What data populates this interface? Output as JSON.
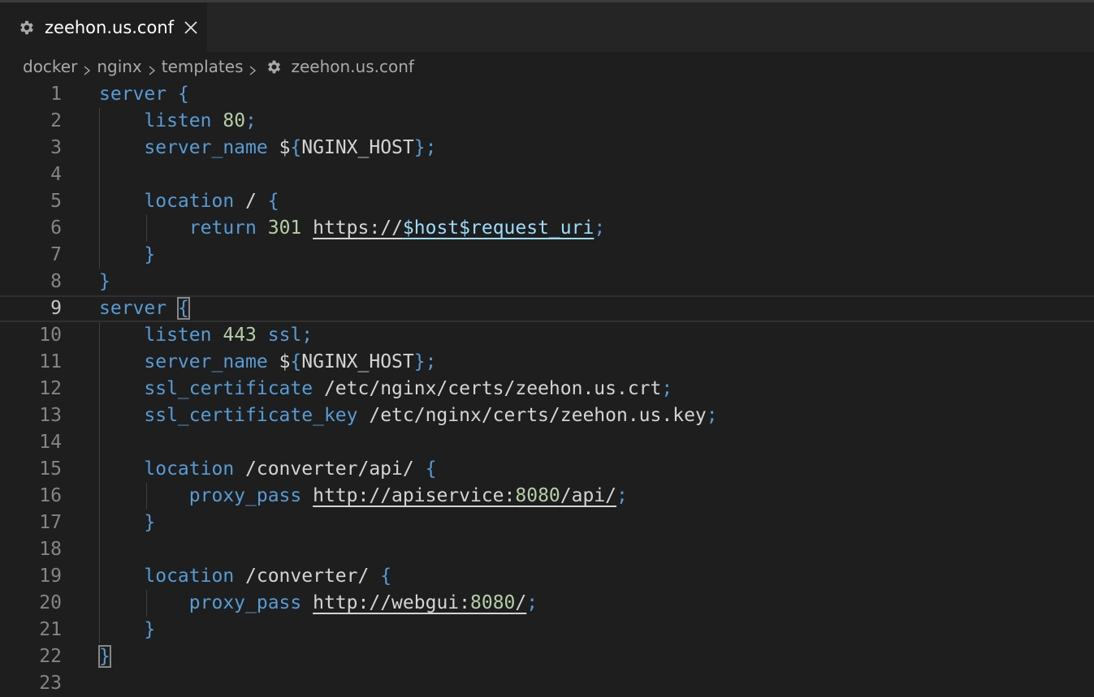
{
  "tab": {
    "icon": "gear-icon",
    "label": "zeehon.us.conf",
    "close_icon": "close-icon"
  },
  "breadcrumb": {
    "items": [
      "docker",
      "nginx",
      "templates"
    ],
    "file_icon": "gear-icon",
    "file": "zeehon.us.conf"
  },
  "editor": {
    "current_line": 9,
    "lines": [
      {
        "n": "1",
        "tokens": [
          [
            "kw",
            "server"
          ],
          [
            "txt",
            " "
          ],
          [
            "brace",
            "{"
          ]
        ]
      },
      {
        "n": "2",
        "tokens": [
          [
            "txt",
            "    "
          ],
          [
            "kw",
            "listen"
          ],
          [
            "txt",
            " "
          ],
          [
            "num",
            "80"
          ],
          [
            "kw",
            ";"
          ]
        ]
      },
      {
        "n": "3",
        "tokens": [
          [
            "txt",
            "    "
          ],
          [
            "kw",
            "server_name"
          ],
          [
            "txt",
            " $"
          ],
          [
            "brace",
            "{"
          ],
          [
            "txt",
            "NGINX_HOST"
          ],
          [
            "brace",
            "}"
          ],
          [
            "kw",
            ";"
          ]
        ]
      },
      {
        "n": "4",
        "tokens": []
      },
      {
        "n": "5",
        "tokens": [
          [
            "txt",
            "    "
          ],
          [
            "kw",
            "location"
          ],
          [
            "txt",
            " / "
          ],
          [
            "brace",
            "{"
          ]
        ]
      },
      {
        "n": "6",
        "tokens": [
          [
            "txt",
            "        "
          ],
          [
            "kw",
            "return"
          ],
          [
            "txt",
            " "
          ],
          [
            "num",
            "301"
          ],
          [
            "txt",
            " "
          ],
          [
            "url",
            "https://"
          ],
          [
            "var",
            "$host$request_uri"
          ],
          [
            "kw",
            ";"
          ]
        ]
      },
      {
        "n": "7",
        "tokens": [
          [
            "txt",
            "    "
          ],
          [
            "brace",
            "}"
          ]
        ]
      },
      {
        "n": "8",
        "tokens": [
          [
            "brace",
            "}"
          ]
        ]
      },
      {
        "n": "9",
        "tokens": [
          [
            "kw",
            "server"
          ],
          [
            "txt",
            " "
          ],
          [
            "brace-hl",
            "{"
          ],
          [
            "cursor",
            ""
          ]
        ]
      },
      {
        "n": "10",
        "tokens": [
          [
            "txt",
            "    "
          ],
          [
            "kw",
            "listen"
          ],
          [
            "txt",
            " "
          ],
          [
            "num",
            "443"
          ],
          [
            "txt",
            " "
          ],
          [
            "kw",
            "ssl;"
          ]
        ]
      },
      {
        "n": "11",
        "tokens": [
          [
            "txt",
            "    "
          ],
          [
            "kw",
            "server_name"
          ],
          [
            "txt",
            " $"
          ],
          [
            "brace",
            "{"
          ],
          [
            "txt",
            "NGINX_HOST"
          ],
          [
            "brace",
            "}"
          ],
          [
            "kw",
            ";"
          ]
        ]
      },
      {
        "n": "12",
        "tokens": [
          [
            "txt",
            "    "
          ],
          [
            "kw",
            "ssl_certificate"
          ],
          [
            "txt",
            " /etc/nginx/certs/zeehon.us.crt"
          ],
          [
            "kw",
            ";"
          ]
        ]
      },
      {
        "n": "13",
        "tokens": [
          [
            "txt",
            "    "
          ],
          [
            "kw",
            "ssl_certificate_key"
          ],
          [
            "txt",
            " /etc/nginx/certs/zeehon.us.key"
          ],
          [
            "kw",
            ";"
          ]
        ]
      },
      {
        "n": "14",
        "tokens": []
      },
      {
        "n": "15",
        "tokens": [
          [
            "txt",
            "    "
          ],
          [
            "kw",
            "location"
          ],
          [
            "txt",
            " /converter/api/ "
          ],
          [
            "brace",
            "{"
          ]
        ]
      },
      {
        "n": "16",
        "tokens": [
          [
            "txt",
            "        "
          ],
          [
            "kw",
            "proxy_pass"
          ],
          [
            "txt",
            " "
          ],
          [
            "url",
            "http://apiservice:"
          ],
          [
            "num-url",
            "8080"
          ],
          [
            "url",
            "/api/"
          ],
          [
            "kw",
            ";"
          ]
        ]
      },
      {
        "n": "17",
        "tokens": [
          [
            "txt",
            "    "
          ],
          [
            "brace",
            "}"
          ]
        ]
      },
      {
        "n": "18",
        "tokens": []
      },
      {
        "n": "19",
        "tokens": [
          [
            "txt",
            "    "
          ],
          [
            "kw",
            "location"
          ],
          [
            "txt",
            " /converter/ "
          ],
          [
            "brace",
            "{"
          ]
        ]
      },
      {
        "n": "20",
        "tokens": [
          [
            "txt",
            "        "
          ],
          [
            "kw",
            "proxy_pass"
          ],
          [
            "txt",
            " "
          ],
          [
            "url",
            "http://webgui:"
          ],
          [
            "num-url",
            "8080"
          ],
          [
            "url",
            "/"
          ],
          [
            "kw",
            ";"
          ]
        ]
      },
      {
        "n": "21",
        "tokens": [
          [
            "txt",
            "    "
          ],
          [
            "brace",
            "}"
          ]
        ]
      },
      {
        "n": "22",
        "tokens": [
          [
            "brace-hl",
            "}"
          ]
        ]
      },
      {
        "n": "23",
        "tokens": []
      }
    ]
  },
  "colors": {
    "background": "#1e1e1e",
    "keyword": "#569cd6",
    "number": "#b5cea8",
    "text": "#d4d4d4",
    "variable": "#9cdcfe",
    "line_number": "#858585"
  }
}
